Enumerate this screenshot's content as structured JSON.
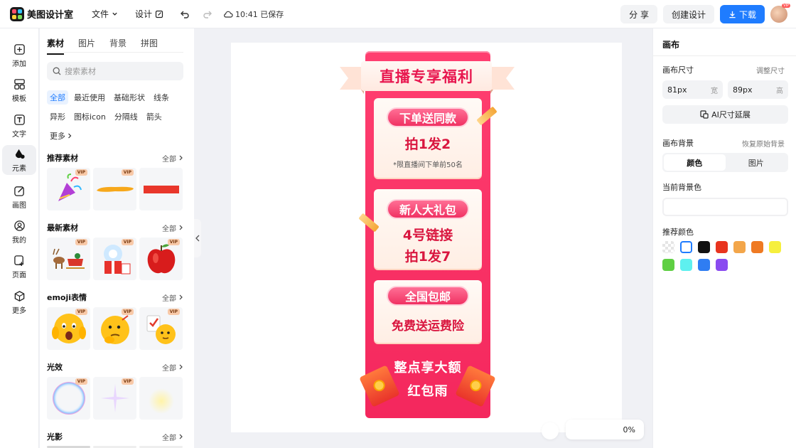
{
  "app": {
    "name": "美图设计室"
  },
  "topbar": {
    "file_label": "文件",
    "design_label": "设计",
    "save_status": "10:41 已保存",
    "share_label": "分 享",
    "create_label": "创建设计",
    "download_label": "下载",
    "vip_badge": "VIP"
  },
  "rail": [
    {
      "label": "添加",
      "icon": "plus-square-icon"
    },
    {
      "label": "模板",
      "icon": "template-icon"
    },
    {
      "label": "文字",
      "icon": "text-icon"
    },
    {
      "label": "元素",
      "icon": "elements-icon"
    },
    {
      "label": "画图",
      "icon": "draw-icon"
    },
    {
      "label": "我的",
      "icon": "user-icon"
    },
    {
      "label": "页面",
      "icon": "page-icon"
    },
    {
      "label": "更多",
      "icon": "more-cube-icon"
    }
  ],
  "panel": {
    "tabs": [
      "素材",
      "图片",
      "背景",
      "拼图"
    ],
    "search_placeholder": "搜索素材",
    "chips": [
      "全部",
      "最近使用",
      "基础形状",
      "线条",
      "异形",
      "图标icon",
      "分隔线",
      "箭头",
      "更多"
    ],
    "all_label": "全部",
    "vip_label": "VIP",
    "sections": [
      {
        "title": "推荐素材"
      },
      {
        "title": "最新素材"
      },
      {
        "title": "emoji表情"
      },
      {
        "title": "光效"
      },
      {
        "title": "光影"
      }
    ]
  },
  "poster": {
    "headline": "直播专享福利",
    "card1_pill": "下单送同款",
    "card1_big": "拍1发2",
    "card1_note": "*限直播间下单前50名",
    "card2_pill": "新人大礼包",
    "card2_line1": "4号链接",
    "card2_line2": "拍1发7",
    "card3_pill": "全国包邮",
    "card3_big": "免费送运费险",
    "footer_line1": "整点享大额",
    "footer_line2": "红包雨"
  },
  "zoom": {
    "text": "0%"
  },
  "right_panel": {
    "title": "画布",
    "size_label": "画布尺寸",
    "adjust_link": "调整尺寸",
    "width_value": "81px",
    "width_unit": "宽",
    "height_value": "89px",
    "height_unit": "高",
    "ai_button": "AI尺寸延展",
    "bg_label": "画布背景",
    "restore_link": "恢复原始背景",
    "seg_color": "颜色",
    "seg_image": "图片",
    "current_bg_label": "当前背景色",
    "recommend_label": "推荐颜色",
    "swatches": [
      "transparent",
      "#ffffff",
      "#111111",
      "#e8341f",
      "#f3a64a",
      "#ef7a23",
      "#f6ef3d",
      "#5fcf43",
      "#5ef0ef",
      "#2f7df2",
      "#8a4bf0"
    ]
  }
}
